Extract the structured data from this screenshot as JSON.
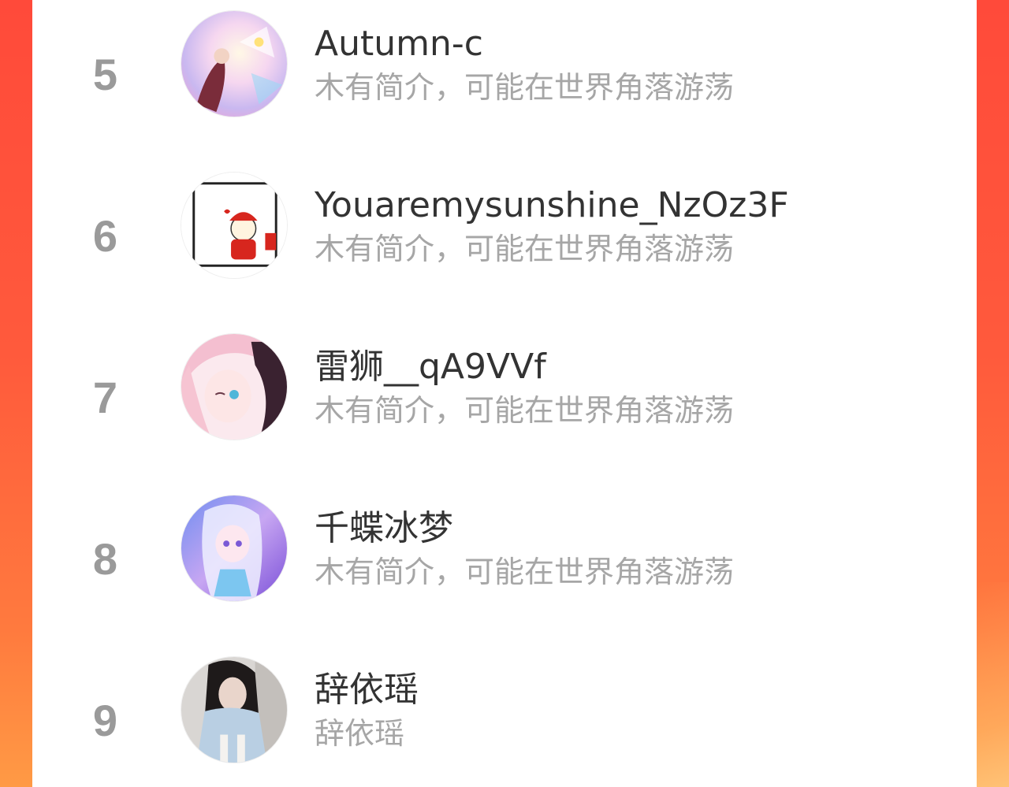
{
  "users": [
    {
      "rank": "5",
      "name": "Autumn-c",
      "bio": "木有简介，可能在世界角落游荡"
    },
    {
      "rank": "6",
      "name": "Youaremysunshine_NzOz3F",
      "bio": "木有简介，可能在世界角落游荡"
    },
    {
      "rank": "7",
      "name": "雷狮__qA9VVf",
      "bio": "木有简介，可能在世界角落游荡"
    },
    {
      "rank": "8",
      "name": "千蝶冰梦",
      "bio": "木有简介，可能在世界角落游荡"
    },
    {
      "rank": "9",
      "name": "辞依瑶",
      "bio": "辞依瑶"
    }
  ],
  "colors": {
    "background_top": "#ff4a3a",
    "background_bottom": "#ff9a45",
    "rank_text": "#9a9a9a",
    "name_text": "#333333",
    "bio_text": "#a6a6a6"
  }
}
